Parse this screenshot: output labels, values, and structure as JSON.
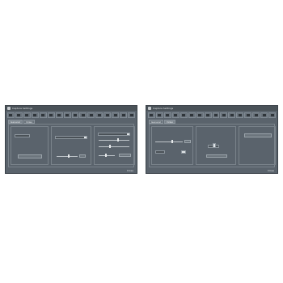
{
  "windows": [
    {
      "title": "Capture Settings",
      "tabs": [
        "General",
        "Video"
      ],
      "active_tab": 0,
      "footer": "Close",
      "toolbar_icons": [
        "back-icon",
        "forward-icon",
        "capture-icon",
        "play-icon",
        "stop-icon",
        "settings-icon",
        "grid-icon",
        "zoom-icon",
        "view-icon",
        "audio-icon",
        "camera-icon",
        "help-icon",
        "info-icon",
        "lock-icon",
        "menu-icon",
        "more-icon"
      ]
    },
    {
      "title": "Capture Settings",
      "tabs": [
        "General",
        "Video"
      ],
      "active_tab": 1,
      "footer": "Close",
      "toolbar_icons": [
        "back-icon",
        "forward-icon",
        "capture-icon",
        "play-icon",
        "stop-icon",
        "settings-icon",
        "grid-icon",
        "zoom-icon",
        "view-icon",
        "audio-icon",
        "camera-icon",
        "help-icon",
        "info-icon",
        "lock-icon",
        "menu-icon",
        "more-icon"
      ]
    }
  ]
}
